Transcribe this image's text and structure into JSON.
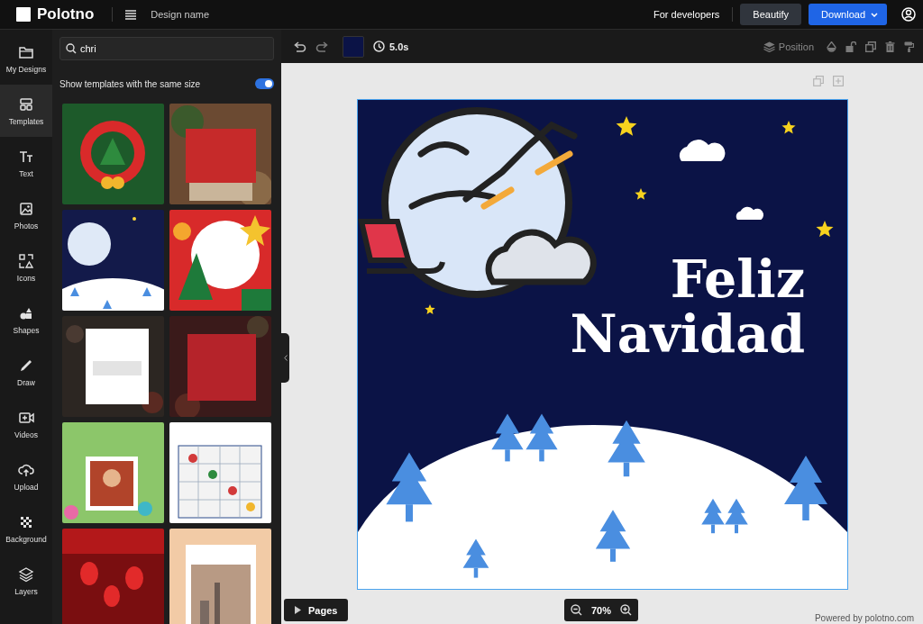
{
  "topbar": {
    "logo": "Polotno",
    "design_name": "Design name",
    "link": "For developers",
    "buttons": [
      {
        "label": "Beautify",
        "kind": "secondary"
      },
      {
        "label": "Download",
        "kind": "primary"
      }
    ]
  },
  "sidebar": {
    "items": [
      {
        "label": "My Designs",
        "kind": "folder",
        "selected": false
      },
      {
        "label": "Templates",
        "kind": "templates",
        "selected": true
      },
      {
        "label": "Text",
        "kind": "text",
        "selected": false
      },
      {
        "label": "Photos",
        "kind": "photos",
        "selected": false
      },
      {
        "label": "Icons",
        "kind": "icons",
        "selected": false
      },
      {
        "label": "Shapes",
        "kind": "shapes",
        "selected": false
      },
      {
        "label": "Draw",
        "kind": "draw",
        "selected": false
      },
      {
        "label": "Videos",
        "kind": "videos",
        "selected": false
      },
      {
        "label": "Upload",
        "kind": "upload",
        "selected": false
      },
      {
        "label": "Background",
        "kind": "background",
        "selected": false
      },
      {
        "label": "Layers",
        "kind": "layers",
        "selected": false
      }
    ]
  },
  "panel": {
    "search": {
      "value": "chri"
    },
    "same_size": {
      "label": "Show templates with the same size",
      "on": true
    }
  },
  "toolbar": {
    "duration": "5.0s",
    "position_label": "Position"
  },
  "canvas": {
    "title_lines": [
      "Feliz",
      "Navidad"
    ]
  },
  "pages_button": "Pages",
  "zoom": "70%",
  "footer": "Powered by polotno.com"
}
